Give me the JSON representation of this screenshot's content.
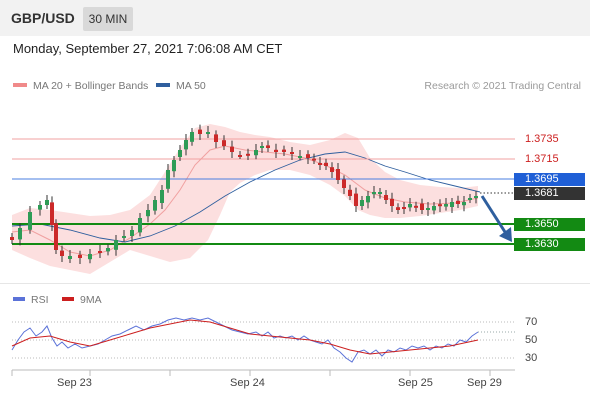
{
  "header": {
    "pair": "GBP/USD",
    "timeframe": "30 MIN"
  },
  "datetime": "Monday, September 27, 2021 7:06:08 AM CET",
  "legend": {
    "bollinger": {
      "label": "MA 20 + Bollinger Bands",
      "color": "#f08a8a"
    },
    "ma50": {
      "label": "MA 50",
      "color": "#2f5f9e"
    }
  },
  "credit": "Research © 2021 Trading Central",
  "levels": {
    "r2": "1.3735",
    "r1": "1.3715",
    "pivot": "1.3695",
    "last": "1.3681",
    "s1": "1.3650",
    "s2": "1.3630"
  },
  "colors": {
    "resistance": "#e05555",
    "pivot": "#3a6fd8",
    "support": "#138a13",
    "bull": "#2e9c56",
    "bear": "#cc2929",
    "arrow": "#2f5f9e"
  },
  "oscillator": {
    "rsi_label": "RSI",
    "ma_label": "9MA",
    "rsi_color": "#5b72d8",
    "ma_color": "#cc1f1f",
    "levels": [
      "70",
      "50",
      "30"
    ]
  },
  "x_labels": [
    "Sep 23",
    "Sep 24",
    "Sep 25",
    "Sep 29"
  ],
  "icons": {
    "forecast_arrow": "down-arrow-icon"
  }
}
